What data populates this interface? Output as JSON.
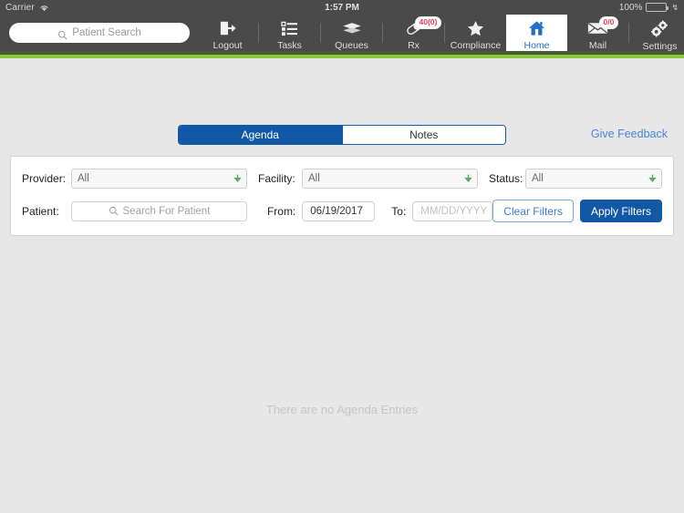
{
  "statusbar": {
    "carrier": "Carrier",
    "wifi_icon": "wifi-icon",
    "time": "1:57 PM",
    "battery_percent": "100%",
    "battery_icon": "battery-icon",
    "charging_icon": "bolt-icon"
  },
  "navbar": {
    "search": {
      "placeholder": "Patient Search",
      "icon": "search-icon",
      "value": ""
    },
    "items": [
      {
        "label": "Logout",
        "icon": "logout-icon",
        "badge": null,
        "active": false
      },
      {
        "label": "Tasks",
        "icon": "tasks-icon",
        "badge": null,
        "active": false
      },
      {
        "label": "Queues",
        "icon": "queues-icon",
        "badge": null,
        "active": false
      },
      {
        "label": "Rx",
        "icon": "pill-icon",
        "badge": "40(0)",
        "active": false
      },
      {
        "label": "Compliance",
        "icon": "star-icon",
        "badge": null,
        "active": false
      },
      {
        "label": "Home",
        "icon": "home-icon",
        "badge": null,
        "active": true
      },
      {
        "label": "Mail",
        "icon": "envelope-icon",
        "badge": "0/0",
        "active": false
      },
      {
        "label": "Settings",
        "icon": "gears-icon",
        "badge": null,
        "active": false
      }
    ]
  },
  "tabs": {
    "agenda": "Agenda",
    "notes": "Notes",
    "selected": "Agenda"
  },
  "feedback_link": "Give Feedback",
  "filters": {
    "provider": {
      "label": "Provider:",
      "value": "All",
      "caret_icon": "chevron-down-icon"
    },
    "facility": {
      "label": "Facility:",
      "value": "All",
      "caret_icon": "chevron-down-icon"
    },
    "status": {
      "label": "Status:",
      "value": "All",
      "caret_icon": "chevron-down-icon"
    },
    "patient": {
      "label": "Patient:",
      "placeholder": "Search For Patient",
      "value": "",
      "icon": "search-icon"
    },
    "from": {
      "label": "From:",
      "value": "06/19/2017"
    },
    "to": {
      "label": "To:",
      "value": "",
      "placeholder": "MM/DD/YYYY"
    },
    "clear_button": "Clear Filters",
    "apply_button": "Apply Filters"
  },
  "main": {
    "empty_message": "There are no Agenda Entries"
  },
  "colors": {
    "chrome": "#4a4a4a",
    "rule_dark": "#4a5a36",
    "rule_green": "#8dc63f",
    "accent_blue": "#1159a6",
    "link_blue": "#4a86d8",
    "badge_red": "#e0405a",
    "caret_green": "#5aab63"
  }
}
